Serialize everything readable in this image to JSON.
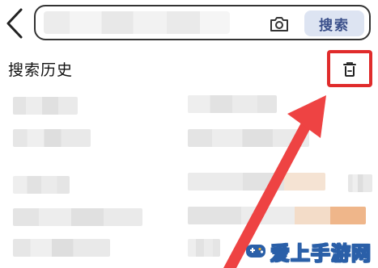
{
  "header": {
    "search_placeholder": "",
    "search_button_label": "搜索"
  },
  "history": {
    "title": "搜索历史"
  },
  "watermark": {
    "text": "爱上手游网"
  },
  "colors": {
    "highlight": "#e02b2b",
    "search_button_bg": "#dde4f2",
    "search_button_text": "#3a4f8a"
  },
  "icons": {
    "back": "back-chevron-icon",
    "camera": "camera-icon",
    "delete": "trash-icon"
  }
}
